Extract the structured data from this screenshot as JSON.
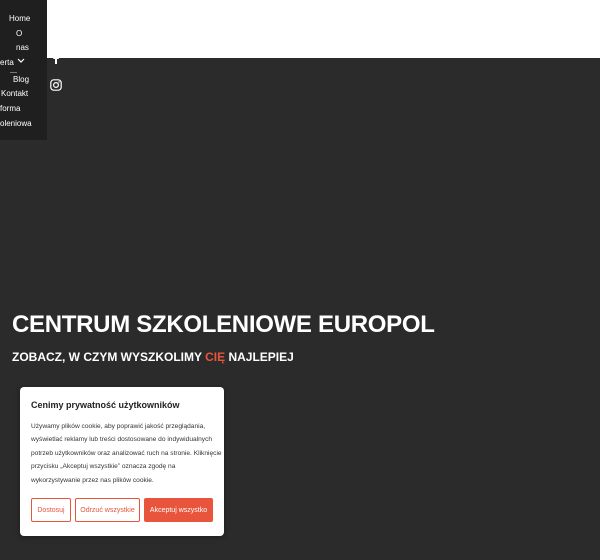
{
  "nav": {
    "items": [
      "Home",
      "O",
      "nas",
      "erta",
      "Blog",
      "Kontakt",
      "forma",
      "oleniowa"
    ]
  },
  "social": {
    "facebook_icon": "facebook-icon",
    "instagram_icon": "instagram-icon"
  },
  "hero": {
    "title": "CENTRUM SZKOLENIOWE EUROPOL",
    "subtitle_before": "ZOBACZ, W CZYM WYSZKOLIMY ",
    "subtitle_accent": "CIĘ",
    "subtitle_after": " NAJLEPIEJ"
  },
  "cookie": {
    "title": "Cenimy prywatność użytkowników",
    "text": "Używamy plików cookie, aby poprawić jakość przeglądania, wyświetlać reklamy lub treści dostosowane do indywidualnych potrzeb użytkowników oraz analizować ruch na stronie. Kliknięcie przycisku „Akceptuj wszystkie” oznacza zgodę na wykorzystywanie przez nas plików cookie.",
    "customize_label": "Dostosuj",
    "reject_label": "Odrzuć wszystkie",
    "accept_label": "Akceptuj wszystko"
  },
  "colors": {
    "accent": "#e8553c",
    "background": "#2b2b2b",
    "menu_bg": "#1f1f1f"
  }
}
